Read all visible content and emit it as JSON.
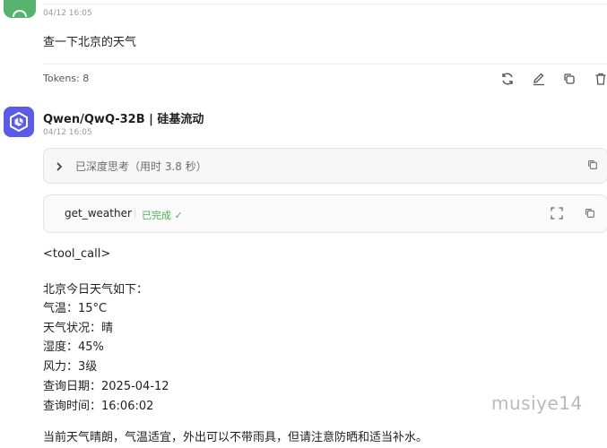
{
  "user_message": {
    "timestamp": "04/12 16:05",
    "text": "查一下北京的天气",
    "tokens": "Tokens: 8"
  },
  "message_actions": [
    {
      "name": "refresh-icon"
    },
    {
      "name": "edit-icon"
    },
    {
      "name": "copy-icon"
    },
    {
      "name": "trash-icon"
    }
  ],
  "assistant": {
    "title": "Qwen/QwQ-32B | 硅基流动",
    "timestamp": "04/12 16:05",
    "thinking_label": "已深度思考（用时 3.8 秒）",
    "tool": {
      "name": "get_weather",
      "status": "已完成 ✓"
    },
    "tool_call_tag": "<tool_call>",
    "weather_lines": [
      "北京今日天气如下：",
      "气温：15°C",
      "天气状况：晴",
      "湿度：45%",
      "风力：3级",
      "查询日期：2025-04-12",
      "查询时间：16:06:02"
    ],
    "advice": "当前天气晴朗，气温适宜，外出可以不带雨具，但请注意防晒和适当补水。"
  },
  "watermark": "musiye14",
  "colors": {
    "user_avatar": "#56b36e",
    "bot_avatar": "#5b5be6",
    "success": "#4caf50"
  }
}
